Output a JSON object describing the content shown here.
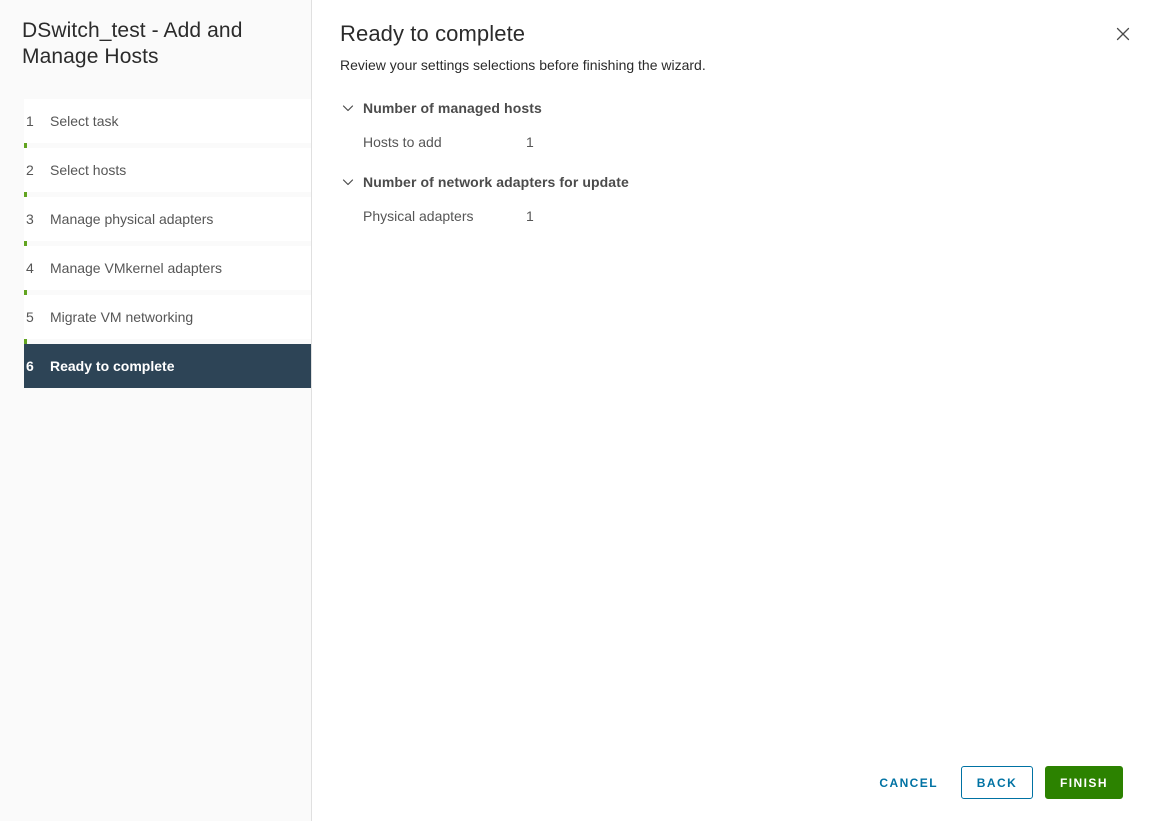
{
  "sidebar": {
    "title": "DSwitch_test - Add and Manage Hosts",
    "progress_color": "#62a420",
    "active_color": "#2d4456",
    "steps": [
      {
        "number": "1",
        "label": "Select task",
        "active": false
      },
      {
        "number": "2",
        "label": "Select hosts",
        "active": false
      },
      {
        "number": "3",
        "label": "Manage physical adapters",
        "active": false
      },
      {
        "number": "4",
        "label": "Manage VMkernel adapters",
        "active": false
      },
      {
        "number": "5",
        "label": "Migrate VM networking",
        "active": false
      },
      {
        "number": "6",
        "label": "Ready to complete",
        "active": true
      }
    ]
  },
  "main": {
    "title": "Ready to complete",
    "subtitle": "Review your settings selections before finishing the wizard.",
    "close_icon": "close-icon",
    "sections": [
      {
        "chevron_icon": "chevron-down-icon",
        "title": "Number of managed hosts",
        "rows": [
          {
            "label": "Hosts to add",
            "value": "1"
          }
        ]
      },
      {
        "chevron_icon": "chevron-down-icon",
        "title": "Number of network adapters for update",
        "rows": [
          {
            "label": "Physical adapters",
            "value": "1"
          }
        ]
      }
    ]
  },
  "footer": {
    "cancel_label": "CANCEL",
    "back_label": "BACK",
    "finish_label": "FINISH",
    "link_color": "#0072a3",
    "finish_color": "#2c8200"
  }
}
